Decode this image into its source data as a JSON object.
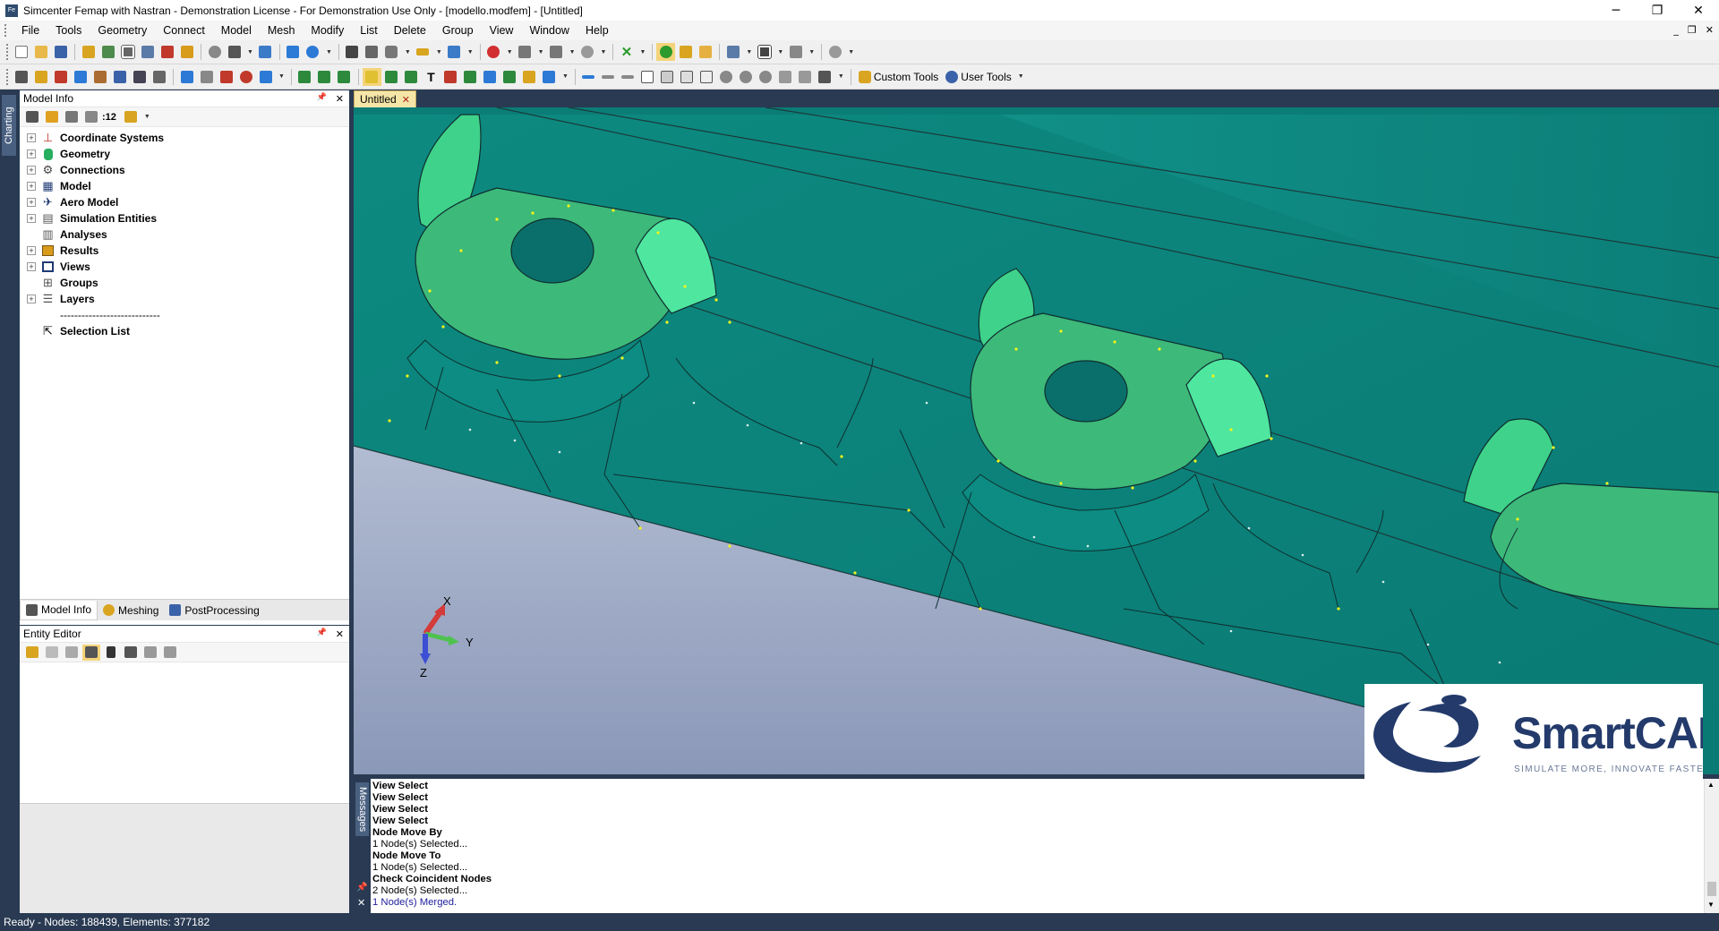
{
  "window": {
    "title": "Simcenter Femap with Nastran - Demonstration License - For Demonstration Use Only - [modello.modfem] - [Untitled]",
    "app_icon_text": "Fe",
    "controls": {
      "minimize": "─",
      "restore": "❐",
      "close": "✕"
    }
  },
  "menu": {
    "items": [
      "File",
      "Tools",
      "Geometry",
      "Connect",
      "Model",
      "Mesh",
      "Modify",
      "List",
      "Delete",
      "Group",
      "View",
      "Window",
      "Help"
    ],
    "mdi_controls": {
      "minimize": "_",
      "restore": "❐",
      "close": "✕"
    }
  },
  "toolbar2": {
    "custom_tools": "Custom Tools",
    "user_tools": "User Tools"
  },
  "left_tab": {
    "label": "Charting"
  },
  "model_info": {
    "title": "Model Info",
    "pin": "📌",
    "close": "✕",
    "toolbar_count": ":12",
    "tree": [
      {
        "label": "Coordinate Systems",
        "expandable": true,
        "icon": "axes-icon",
        "color": "#c0392b"
      },
      {
        "label": "Geometry",
        "expandable": true,
        "icon": "cylinder-icon",
        "color": "#27ae60"
      },
      {
        "label": "Connections",
        "expandable": true,
        "icon": "connection-icon",
        "color": "#555555"
      },
      {
        "label": "Model",
        "expandable": true,
        "icon": "grid-icon",
        "color": "#1f3b73"
      },
      {
        "label": "Aero Model",
        "expandable": true,
        "icon": "aero-icon",
        "color": "#1f3b73"
      },
      {
        "label": "Simulation Entities",
        "expandable": true,
        "icon": "sim-icon",
        "color": "#555555"
      },
      {
        "label": "Analyses",
        "expandable": false,
        "icon": "analysis-icon",
        "color": "#555555"
      },
      {
        "label": "Results",
        "expandable": true,
        "icon": "results-icon",
        "color": "#d89b1a"
      },
      {
        "label": "Views",
        "expandable": true,
        "icon": "views-icon",
        "color": "#1f3b73"
      },
      {
        "label": "Groups",
        "expandable": false,
        "icon": "groups-icon",
        "color": "#555555"
      },
      {
        "label": "Layers",
        "expandable": true,
        "icon": "layers-icon",
        "color": "#555555"
      }
    ],
    "separator": "----------------------------",
    "selection_list": "Selection List",
    "tabs": [
      "Model Info",
      "Meshing",
      "PostProcessing"
    ]
  },
  "entity_editor": {
    "title": "Entity Editor",
    "pin": "📌",
    "close": "✕"
  },
  "document": {
    "tab_label": "Untitled",
    "close": "✕"
  },
  "triad": {
    "x": "X",
    "y": "Y",
    "z": "Z"
  },
  "logo": {
    "name": "SmartCAE",
    "tagline": "SIMULATE MORE, INNOVATE FASTER"
  },
  "messages": {
    "label": "Messages",
    "lines": [
      {
        "text": "View Select",
        "style": "bold"
      },
      {
        "text": "View Select",
        "style": "bold"
      },
      {
        "text": "View Select",
        "style": "bold"
      },
      {
        "text": "View Select",
        "style": "bold"
      },
      {
        "text": "Node Move By",
        "style": "bold"
      },
      {
        "text": "1 Node(s) Selected...",
        "style": "normal"
      },
      {
        "text": "Node Move To",
        "style": "bold"
      },
      {
        "text": "1 Node(s) Selected...",
        "style": "normal"
      },
      {
        "text": "Check Coincident Nodes",
        "style": "bold"
      },
      {
        "text": "2 Node(s) Selected...",
        "style": "normal"
      },
      {
        "text": "1 Node(s) Merged.",
        "style": "blue"
      }
    ]
  },
  "status": {
    "text": "Ready - Nodes: 188439,  Elements: 377182"
  },
  "colors": {
    "accent_dark": "#293a52",
    "mesh_teal": "#0f8f86",
    "face_green": "#3cba7a",
    "tab_yellow": "#f5e6a8"
  }
}
